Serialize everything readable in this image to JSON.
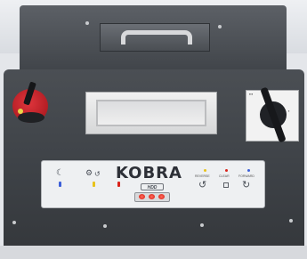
{
  "device": {
    "brand": "KOBRA",
    "model": "HDD",
    "status_leds": {
      "count": 3,
      "color": "#e8231a"
    },
    "indicator_icons": [
      "moon-icon",
      "thumbs-icon",
      "fire-icon"
    ],
    "control_labels": [
      "REVERSE",
      "CLEAR",
      "FORWARD"
    ],
    "body_color": "#45494e",
    "key_color": "#c21d24"
  }
}
